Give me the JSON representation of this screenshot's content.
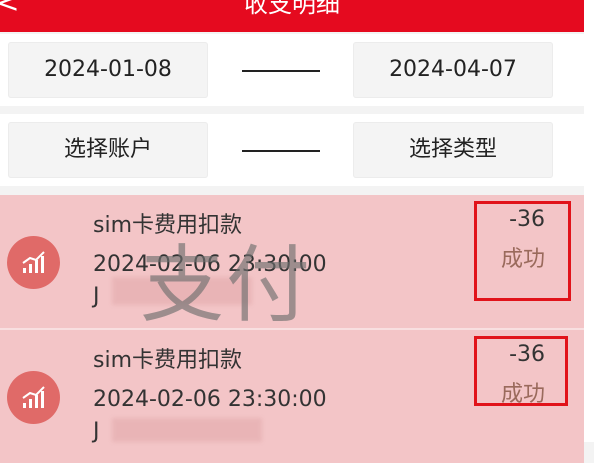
{
  "header": {
    "back_glyph": "<",
    "title": "收支明细"
  },
  "filters": {
    "start_date": "2024-01-08",
    "end_date": "2024-04-07",
    "account_button": "选择账户",
    "type_button": "选择类型"
  },
  "records": [
    {
      "name": "sim卡费用扣款",
      "time": "2024-02-06 23:30:00",
      "account": "J",
      "amount": "-36",
      "status": "成功"
    },
    {
      "name": "sim卡费用扣款",
      "time": "2024-02-06 23:30:00",
      "account": "J",
      "amount": "-36",
      "status": "成功"
    }
  ],
  "watermark": "支付",
  "icons": {
    "record_icon": "bar-chart-icon"
  },
  "colors": {
    "header": "#e50a1f",
    "item_bg": "#f3c5c7",
    "icon_bg": "#e06a68",
    "highlight": "#e1131a"
  }
}
